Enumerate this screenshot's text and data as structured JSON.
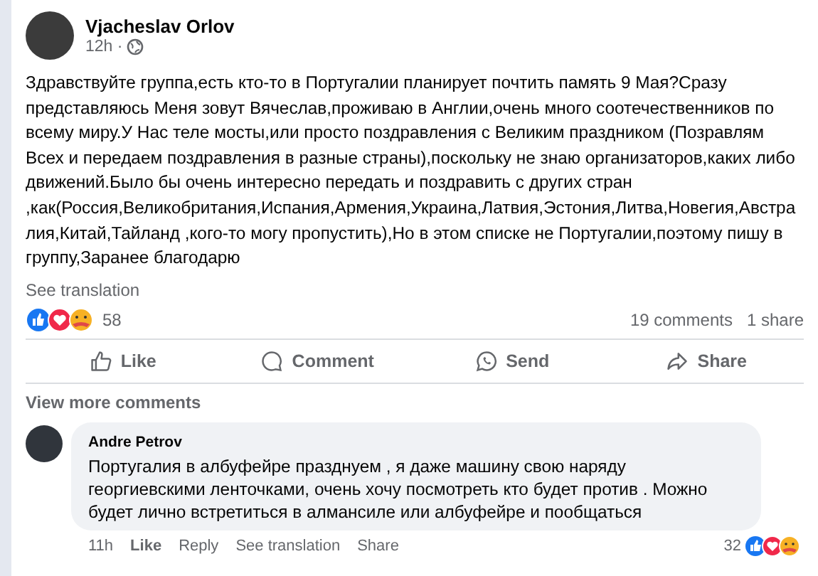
{
  "post": {
    "author": "Vjacheslav Orlov",
    "time": "12h ·",
    "text": "Здравствуйте группа,есть кто-то в Португалии планирует почтить память 9 Мая?Сразу представляюсь Меня зовут Вячеслав,проживаю в Англии,очень много соотечественников по всему миру.У Нас теле мосты,или просто поздравления с Великим праздником (Позравлям Всех и передаем поздравления в разные страны),поскольку не знаю организаторов,каких либо движений.Было бы очень интересно передать и поздравить с других стран ,как(Россия,Великобритания,Испания,Армения,Украина,Латвия,Эстония,Литва,Новегия,Австралия,Китай,Тайланд ,кого-то могу пропустить),Но в этом списке не Португалии,поэтому пишу в группу,Заранее благодарю",
    "see_translation": "See translation",
    "reaction_count": "58",
    "comments_count": "19 comments",
    "shares_count": "1 share"
  },
  "actions": [
    {
      "kind": "like",
      "label": "Like"
    },
    {
      "kind": "comment",
      "label": "Comment"
    },
    {
      "kind": "send",
      "label": "Send"
    },
    {
      "kind": "share",
      "label": "Share"
    }
  ],
  "view_more_comments": "View more comments",
  "comment": {
    "author": "Andre Petrov",
    "text": "Португалия в албуфейре празднуем , я даже машину свою наряду георгиевскими ленточками, очень хочу посмотреть кто будет против . Можно будет лично встретиться в алмансиле или албуфейре и пообщаться",
    "time": "11h",
    "links": [
      "Like",
      "Reply",
      "See translation",
      "Share"
    ],
    "reaction_count": "32"
  }
}
